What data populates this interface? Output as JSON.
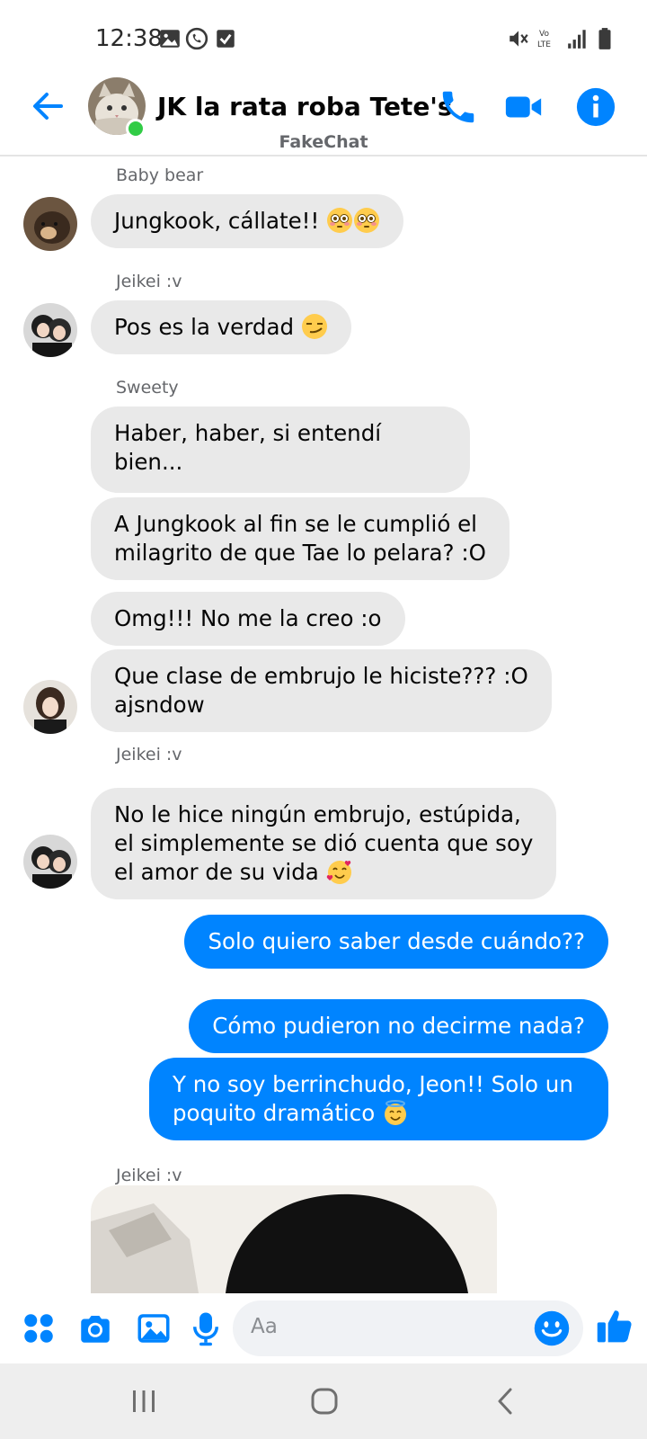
{
  "status_bar": {
    "time": "12:38"
  },
  "header": {
    "title": "JK la rata roba Tete's",
    "subtitle": "FakeChat"
  },
  "colors": {
    "accent": "#0084ff",
    "incoming_bubble": "#e9e9e9",
    "online": "#31cc46"
  },
  "messages": {
    "group1": {
      "sender": "Baby bear",
      "texts": [
        "Jungkook, cállate!!"
      ]
    },
    "group2": {
      "sender": "Jeikei :v",
      "texts": [
        "Pos es la verdad"
      ]
    },
    "group3": {
      "sender": "Sweety",
      "texts": [
        "Haber, haber, si entendí bien...",
        "A Jungkook al fin se le cumplió el\nmilagrito de que Tae lo pelara? :O",
        "Omg!!! No me la creo :o",
        "Que clase de embrujo le hiciste??? :O\najsndow"
      ]
    },
    "group4": {
      "sender": "Jeikei :v",
      "texts": [
        "No le hice ningún embrujo, estúpida,\nel simplemente se dió cuenta que soy\nel amor de su vida"
      ]
    },
    "outgoing": [
      "Solo quiero saber desde cuándo??",
      "Cómo pudieron no decirme nada?",
      "Y no soy berrinchudo, Jeon!! Solo un\npoquito dramático"
    ],
    "group5": {
      "sender": "Jeikei :v"
    }
  },
  "composer": {
    "placeholder": "Aa"
  },
  "icons": {
    "back": "back-arrow-icon",
    "call": "phone-icon",
    "video": "video-camera-icon",
    "info": "info-icon",
    "menu": "four-dots-icon",
    "camera": "camera-icon",
    "gallery": "image-icon",
    "mic": "microphone-icon",
    "emoji": "emoji-icon",
    "like": "thumbs-up-icon"
  }
}
